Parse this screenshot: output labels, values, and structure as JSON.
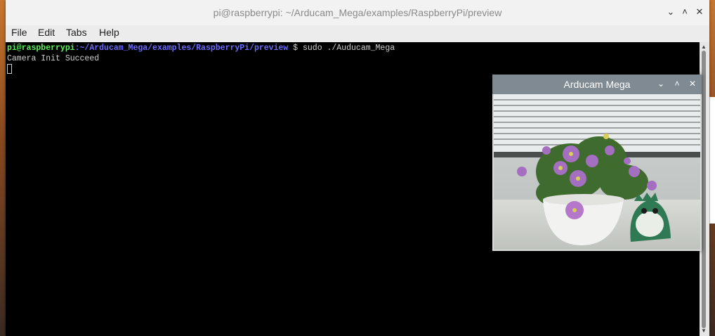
{
  "window": {
    "title": "pi@raspberrypi: ~/Arducam_Mega/examples/RaspberryPi/preview",
    "controls": {
      "minimize": "⌄",
      "maximize": "˄",
      "close": "✕"
    }
  },
  "menu": [
    "File",
    "Edit",
    "Tabs",
    "Help"
  ],
  "terminal": {
    "prompt_user": "pi@raspberrypi",
    "prompt_sep": ":",
    "prompt_path": "~/Arducam_Mega/examples/RaspberryPi/preview",
    "prompt_symbol": " $ ",
    "command": "sudo ./Auducam_Mega",
    "output": "Camera Init Succeed"
  },
  "preview": {
    "title": "Arducam Mega",
    "controls": {
      "minimize": "⌄",
      "maximize": "˄",
      "close": "✕"
    }
  },
  "colors": {
    "prompt_user": "#5ff05f",
    "prompt_path": "#6a6aff",
    "terminal_bg": "#000000",
    "preview_titlebar": "#7f8a93"
  }
}
